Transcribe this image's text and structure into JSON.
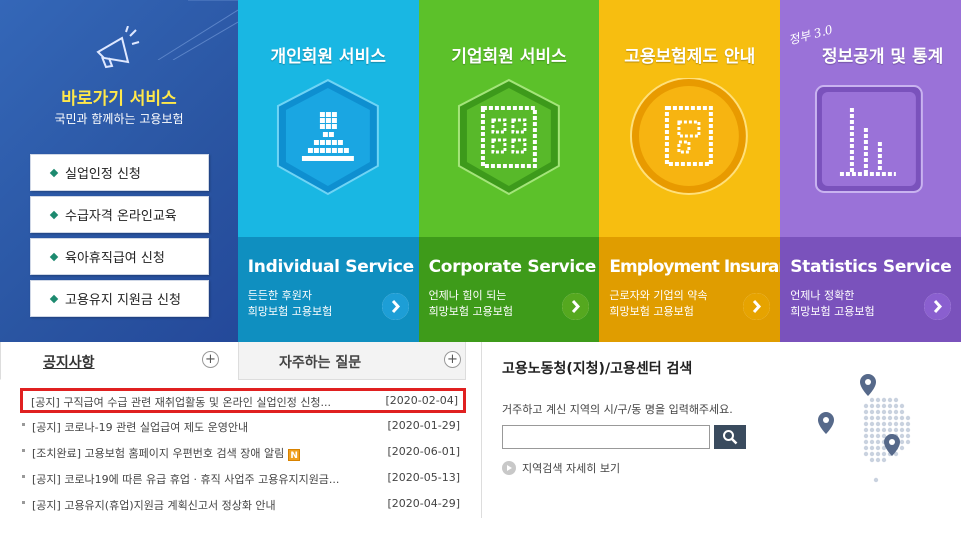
{
  "quick": {
    "title": "바로가기 서비스",
    "subtitle": "국민과 함께하는 고용보험",
    "buttons": [
      {
        "label": "실업인정 신청"
      },
      {
        "label": "수급자격 온라인교육"
      },
      {
        "label": "육아휴직급여 신청"
      },
      {
        "label": "고용유지 지원금 신청"
      }
    ]
  },
  "tiles": [
    {
      "title": "개인회원 서비스",
      "english": "Individual Service",
      "desc1": "든든한 후원자",
      "desc2": "희망보험 고용보험",
      "top_color": "#19b7e3",
      "bottom_color": "#0f8fc0",
      "icon": "person-icon",
      "arrow_color": "#1d9ed6"
    },
    {
      "title": "기업회원 서비스",
      "english": "Corporate Service",
      "desc1": "언제나 힘이 되는",
      "desc2": "희망보험 고용보험",
      "top_color": "#5cc12a",
      "bottom_color": "#3e9b1a",
      "icon": "building-icon",
      "arrow_color": "#55a81f"
    },
    {
      "title": "고용보험제도 안내",
      "english": "Employment Insurance",
      "desc1": "근로자와 기업의 약속",
      "desc2": "희망보험 고용보험",
      "top_color": "#f7be10",
      "bottom_color": "#e09d00",
      "icon": "document-icon",
      "arrow_color": "#e6a300"
    },
    {
      "title": "정보공개 및 통계",
      "english": "Statistics Service",
      "desc1": "언제나 정확한",
      "desc2": "희망보험 고용보험",
      "top_color": "#9a72d8",
      "bottom_color": "#7a52bc",
      "icon": "bar-chart-icon",
      "arrow_color": "#8a5fcf",
      "handwriting": "정부 3.0"
    }
  ],
  "board": {
    "tab_notice": "공지사항",
    "tab_faq": "자주하는 질문",
    "plus": "+",
    "items": [
      {
        "text": "[공지] 구직급여 수급 관련 재취업활동 및 온라인 실업인정 신청...",
        "date": "[2020-02-04]",
        "new": ""
      },
      {
        "text": "[공지] 코로나-19 관련 실업급여 제도 운영안내",
        "date": "[2020-01-29]",
        "new": ""
      },
      {
        "text": "[조치완료] 고용보험 홈페이지 우편번호 검색 장애 알림",
        "date": "[2020-06-01]",
        "new": "N"
      },
      {
        "text": "[공지] 코로나19에 따른 유급 휴업 · 휴직 사업주 고용유지지원금...",
        "date": "[2020-05-13]",
        "new": ""
      },
      {
        "text": "[공지] 고용유지(휴업)지원금 계획신고서 정상화 안내",
        "date": "[2020-04-29]",
        "new": ""
      }
    ]
  },
  "search": {
    "title": "고용노동청(지청)/고용센터 검색",
    "hint": "거주하고 계신 지역의 시/구/동 명을 입력해주세요.",
    "value": "",
    "more": "지역검색 자세히 보기"
  }
}
